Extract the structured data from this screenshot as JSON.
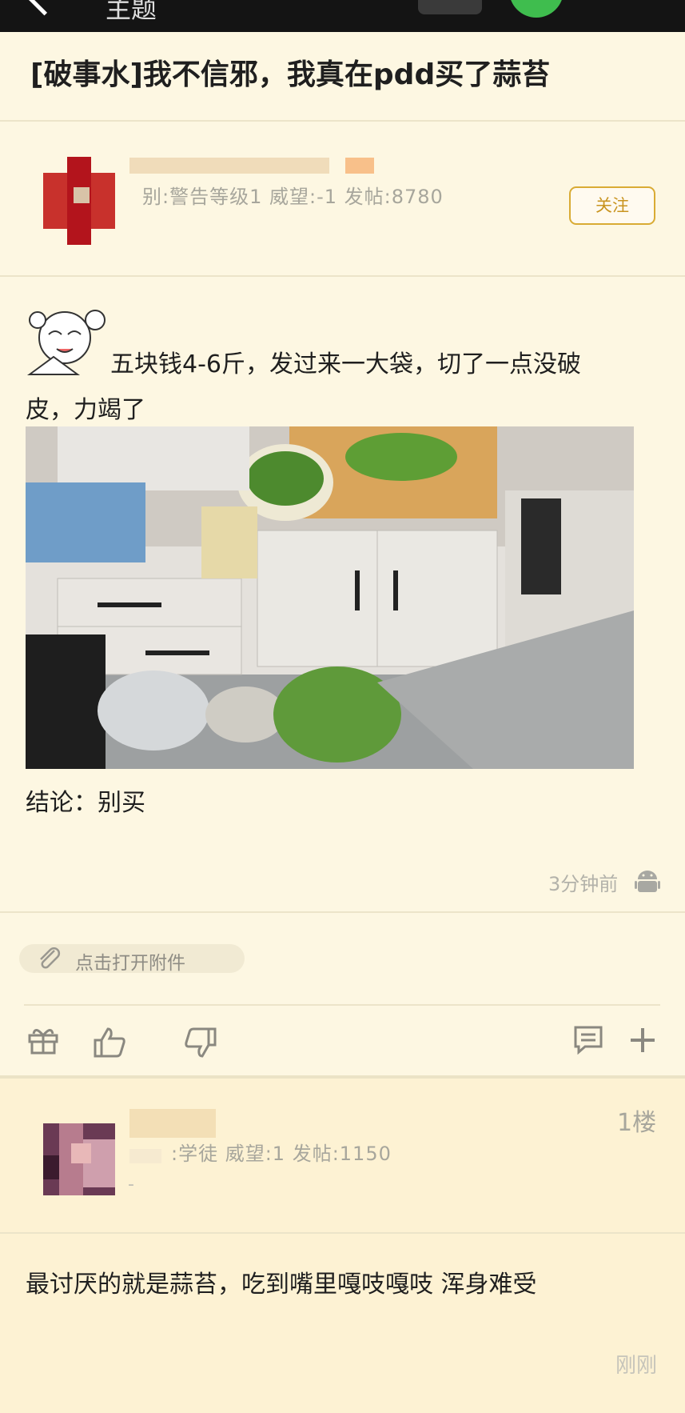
{
  "top_bar": {
    "title": "主题"
  },
  "post": {
    "title": "[破事水]我不信邪，我真在pdd买了蒜苔",
    "author_meta": "别:警告等级1 威望:-1 发帖:8780",
    "follow_label": "关注",
    "body_line1": "五块钱4-6斤，发过来一大袋，切了一点没破",
    "body_line2": "皮，力竭了",
    "conclusion": "结论：别买",
    "time": "3分钟前",
    "attachment_label": "点击打开附件"
  },
  "reply": {
    "floor": "1楼",
    "author_meta": ":学徒 威望:1 发帖:1150",
    "dash": "-",
    "text": "最讨厌的就是蒜苔，吃到嘴里嘎吱嘎吱 浑身难受",
    "time": "刚刚"
  },
  "icons": [
    "back-icon",
    "android-icon",
    "paperclip-icon",
    "gift-icon",
    "thumbs-up-icon",
    "thumbs-down-icon",
    "comment-icon",
    "plus-icon"
  ]
}
